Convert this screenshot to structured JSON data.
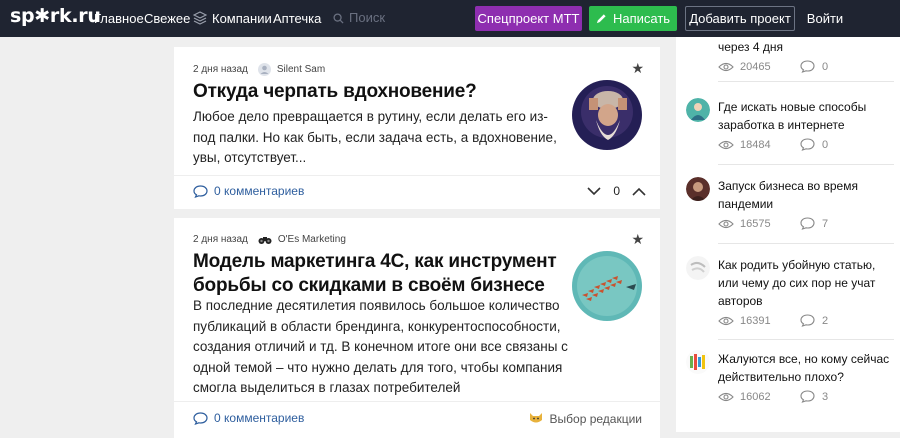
{
  "header": {
    "logo": "sp✱rk.ru",
    "nav": [
      "Главное",
      "Свежее",
      "Компании",
      "Аптечка"
    ],
    "search_placeholder": "Поиск",
    "btn_special": "Спецпроект МТТ",
    "btn_write": "Написать",
    "btn_add": "Добавить проект",
    "btn_login": "Войти"
  },
  "posts": [
    {
      "date": "2 дня назад",
      "author": "Silent Sam",
      "title": "Откуда черпать вдохновение?",
      "excerpt": "Любое дело превращается в рутину, если делать его из-под палки. Но как быть, если задача есть, а вдохновение, увы, отсутствует...",
      "comments": "0 комментариев",
      "votes": "0"
    },
    {
      "date": "2 дня назад",
      "author": "O'Es Marketing",
      "title": "Модель маркетинга 4С, как инструмент борьбы со скидками в своём бизнесе",
      "excerpt": "В последние десятилетия появилось большое количество публикаций в области брендинга, конкурентоспособности, создания отличий и тд. В конечном итоге они все связаны с одной темой – что нужно делать для того, чтобы компания смогла выделиться в глазах потребителей",
      "comments": "0 комментариев",
      "editors_choice": "Выбор редакции"
    }
  ],
  "sidebar": [
    {
      "title": "через 4 дня",
      "views": "20465",
      "comments": "0"
    },
    {
      "title": "Где искать новые способы заработка в интернете",
      "views": "18484",
      "comments": "0"
    },
    {
      "title": "Запуск бизнеса во время пандемии",
      "views": "16575",
      "comments": "7"
    },
    {
      "title": "Как родить убойную статью, или чему до сих пор не учат авторов",
      "views": "16391",
      "comments": "2"
    },
    {
      "title": "Жалуются все, но кому сейчас действительно плохо?",
      "views": "16062",
      "comments": "3"
    }
  ],
  "colors": {
    "header_bg": "#1f2431",
    "special": "#8e2eb0",
    "write": "#2dbc4e",
    "link": "#2e5e9e"
  }
}
